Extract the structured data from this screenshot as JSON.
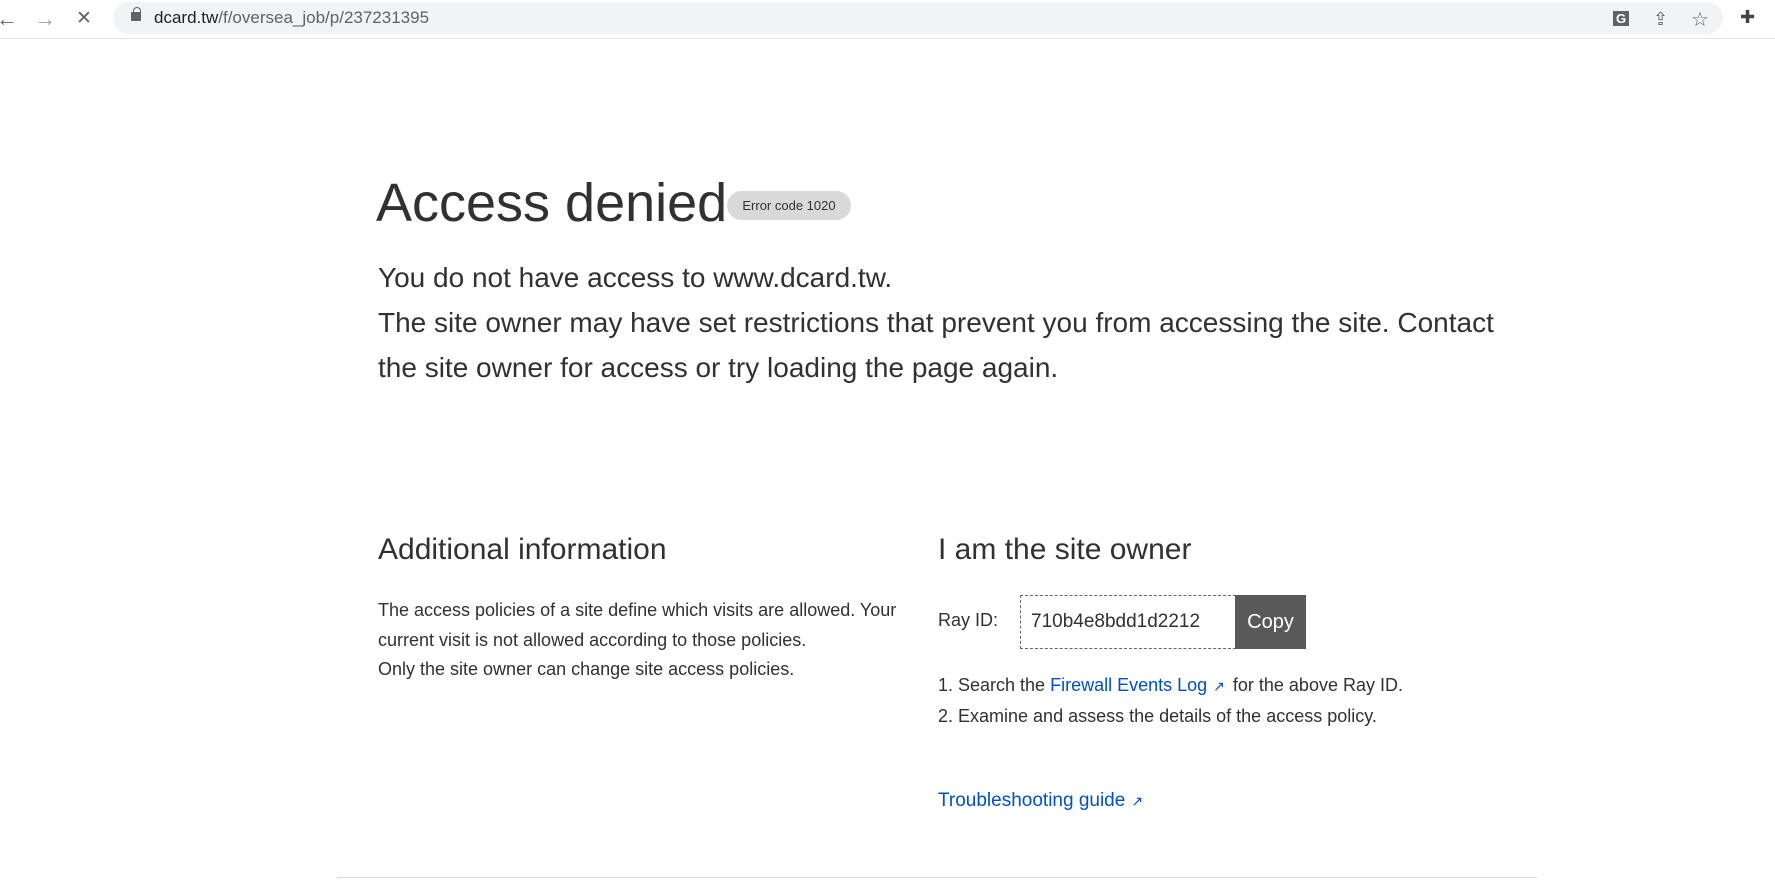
{
  "browser": {
    "url_host": "dcard.tw",
    "url_path": "/f/oversea_job/p/237231395",
    "back_icon": "←",
    "forward_icon": "→",
    "stop_icon": "✕",
    "translate_icon": "G",
    "share_icon": "⇪",
    "star_icon": "☆",
    "extensions_icon": "✚"
  },
  "page": {
    "title": "Access denied",
    "error_badge": "Error code 1020",
    "subtitle_line1": "You do not have access to www.dcard.tw.",
    "subtitle_line2": "The site owner may have set restrictions that prevent you from accessing the site. Contact the site owner for access or try loading the page again.",
    "additional": {
      "heading": "Additional information",
      "p1": "The access policies of a site define which visits are allowed. Your current visit is not allowed according to those policies.",
      "p2": "Only the site owner can change site access policies."
    },
    "owner": {
      "heading": "I am the site owner",
      "ray_label": "Ray ID:",
      "ray_id": "710b4e8bdd1d2212",
      "copy_label": "Copy",
      "step1_prefix": "1. Search the ",
      "step1_link": "Firewall Events Log",
      "step1_suffix": "for the above Ray ID.",
      "step2": "2. Examine and assess the details of the access policy.",
      "troubleshooting": "Troubleshooting guide",
      "external_icon": "↗"
    },
    "link_color": "#0051c3"
  }
}
